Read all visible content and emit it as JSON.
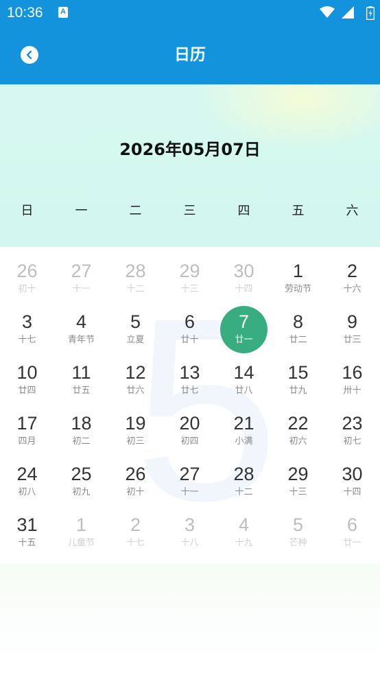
{
  "status_bar": {
    "time": "10:36",
    "notification_icon": "A"
  },
  "app_bar": {
    "title": "日历",
    "back_icon": "chevron-left-icon"
  },
  "header": {
    "date_title": "2026年05月07日"
  },
  "weekdays": [
    "日",
    "一",
    "二",
    "三",
    "四",
    "五",
    "六"
  ],
  "watermark": "5",
  "colors": {
    "primary": "#1393db",
    "selected": "#38ae80",
    "header_bg": "#d2f7ee"
  },
  "weeks": [
    [
      {
        "day": "26",
        "lunar": "初十",
        "faded": true
      },
      {
        "day": "27",
        "lunar": "十一",
        "faded": true
      },
      {
        "day": "28",
        "lunar": "十二",
        "faded": true
      },
      {
        "day": "29",
        "lunar": "十三",
        "faded": true
      },
      {
        "day": "30",
        "lunar": "十四",
        "faded": true
      },
      {
        "day": "1",
        "lunar": "劳动节",
        "faded": false
      },
      {
        "day": "2",
        "lunar": "十六",
        "faded": false
      }
    ],
    [
      {
        "day": "3",
        "lunar": "十七",
        "faded": false
      },
      {
        "day": "4",
        "lunar": "青年节",
        "faded": false
      },
      {
        "day": "5",
        "lunar": "立夏",
        "faded": false
      },
      {
        "day": "6",
        "lunar": "廿十",
        "faded": false
      },
      {
        "day": "7",
        "lunar": "廿一",
        "faded": false,
        "selected": true
      },
      {
        "day": "8",
        "lunar": "廿二",
        "faded": false
      },
      {
        "day": "9",
        "lunar": "廿三",
        "faded": false
      }
    ],
    [
      {
        "day": "10",
        "lunar": "廿四",
        "faded": false
      },
      {
        "day": "11",
        "lunar": "廿五",
        "faded": false
      },
      {
        "day": "12",
        "lunar": "廿六",
        "faded": false
      },
      {
        "day": "13",
        "lunar": "廿七",
        "faded": false
      },
      {
        "day": "14",
        "lunar": "廿八",
        "faded": false
      },
      {
        "day": "15",
        "lunar": "廿九",
        "faded": false
      },
      {
        "day": "16",
        "lunar": "卅十",
        "faded": false
      }
    ],
    [
      {
        "day": "17",
        "lunar": "四月",
        "faded": false
      },
      {
        "day": "18",
        "lunar": "初二",
        "faded": false
      },
      {
        "day": "19",
        "lunar": "初三",
        "faded": false
      },
      {
        "day": "20",
        "lunar": "初四",
        "faded": false
      },
      {
        "day": "21",
        "lunar": "小满",
        "faded": false
      },
      {
        "day": "22",
        "lunar": "初六",
        "faded": false
      },
      {
        "day": "23",
        "lunar": "初七",
        "faded": false
      }
    ],
    [
      {
        "day": "24",
        "lunar": "初八",
        "faded": false
      },
      {
        "day": "25",
        "lunar": "初九",
        "faded": false
      },
      {
        "day": "26",
        "lunar": "初十",
        "faded": false
      },
      {
        "day": "27",
        "lunar": "十一",
        "faded": false
      },
      {
        "day": "28",
        "lunar": "十二",
        "faded": false
      },
      {
        "day": "29",
        "lunar": "十三",
        "faded": false
      },
      {
        "day": "30",
        "lunar": "十四",
        "faded": false
      }
    ],
    [
      {
        "day": "31",
        "lunar": "十五",
        "faded": false
      },
      {
        "day": "1",
        "lunar": "儿童节",
        "faded": true
      },
      {
        "day": "2",
        "lunar": "十七",
        "faded": true
      },
      {
        "day": "3",
        "lunar": "十八",
        "faded": true
      },
      {
        "day": "4",
        "lunar": "十九",
        "faded": true
      },
      {
        "day": "5",
        "lunar": "芒种",
        "faded": true
      },
      {
        "day": "6",
        "lunar": "廿一",
        "faded": true
      }
    ]
  ]
}
